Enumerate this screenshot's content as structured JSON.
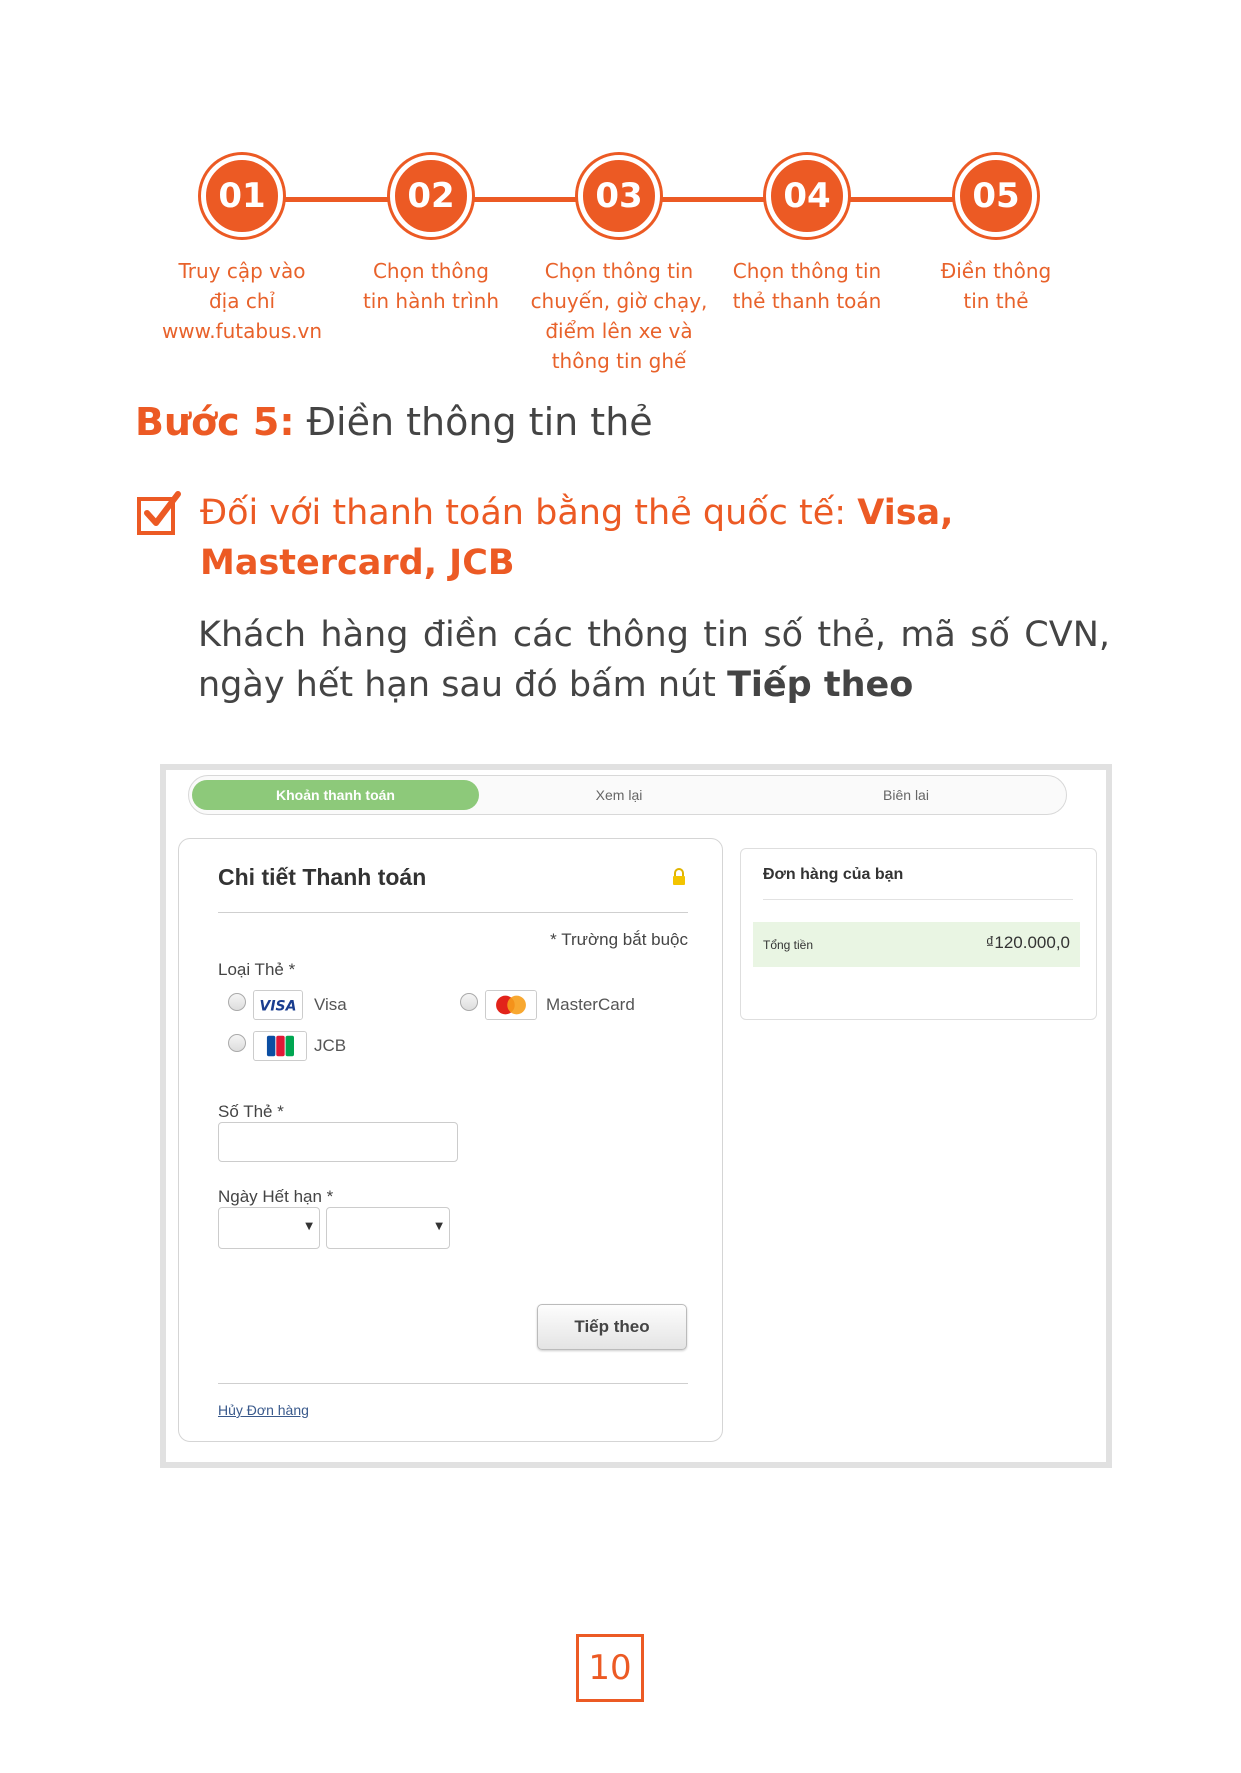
{
  "steps": [
    {
      "number": "01",
      "label": "Truy cập vào\nđịa chỉ\nwww.futabus.vn"
    },
    {
      "number": "02",
      "label": "Chọn thông\ntin hành trình"
    },
    {
      "number": "03",
      "label": "Chọn thông tin\nchuyến, giờ chạy,\nđiểm lên xe và\nthông tin ghế"
    },
    {
      "number": "04",
      "label": "Chọn thông tin\nthẻ thanh toán"
    },
    {
      "number": "05",
      "label": "Điền thông\ntin thẻ"
    }
  ],
  "heading": {
    "step": "Bước 5:",
    "title": "Điền thông tin thẻ"
  },
  "intl_card": {
    "title_prefix": "Đối với thanh toán bằng thẻ quốc tế:",
    "title_brands": "Visa, Mastercard, JCB"
  },
  "instruction": {
    "text": "Khách hàng điền các thông tin số thẻ, mã số CVN, ngày hết hạn sau đó bấm nút",
    "button_name": "Tiếp theo"
  },
  "screenshot": {
    "tabs": [
      "Khoản thanh toán",
      "Xem lại",
      "Biên lai"
    ],
    "payment_title": "Chi tiết Thanh toán",
    "required_note": "* Trường bắt buộc",
    "card_type_label": "Loại Thẻ *",
    "card_options": [
      "Visa",
      "MasterCard",
      "JCB"
    ],
    "card_number_label": "Số Thẻ *",
    "expiry_label": "Ngày Hết hạn *",
    "next_button": "Tiếp theo",
    "cancel_link": "Hủy Đơn hàng",
    "order_title": "Đơn hàng của bạn",
    "total_label": "Tổng tiền",
    "total_amount": "₫120.000,0"
  },
  "page_number": "10",
  "colors": {
    "accent": "#ec5a24",
    "tab_active": "#8dc97a",
    "total_bg": "#e9f5e3"
  }
}
